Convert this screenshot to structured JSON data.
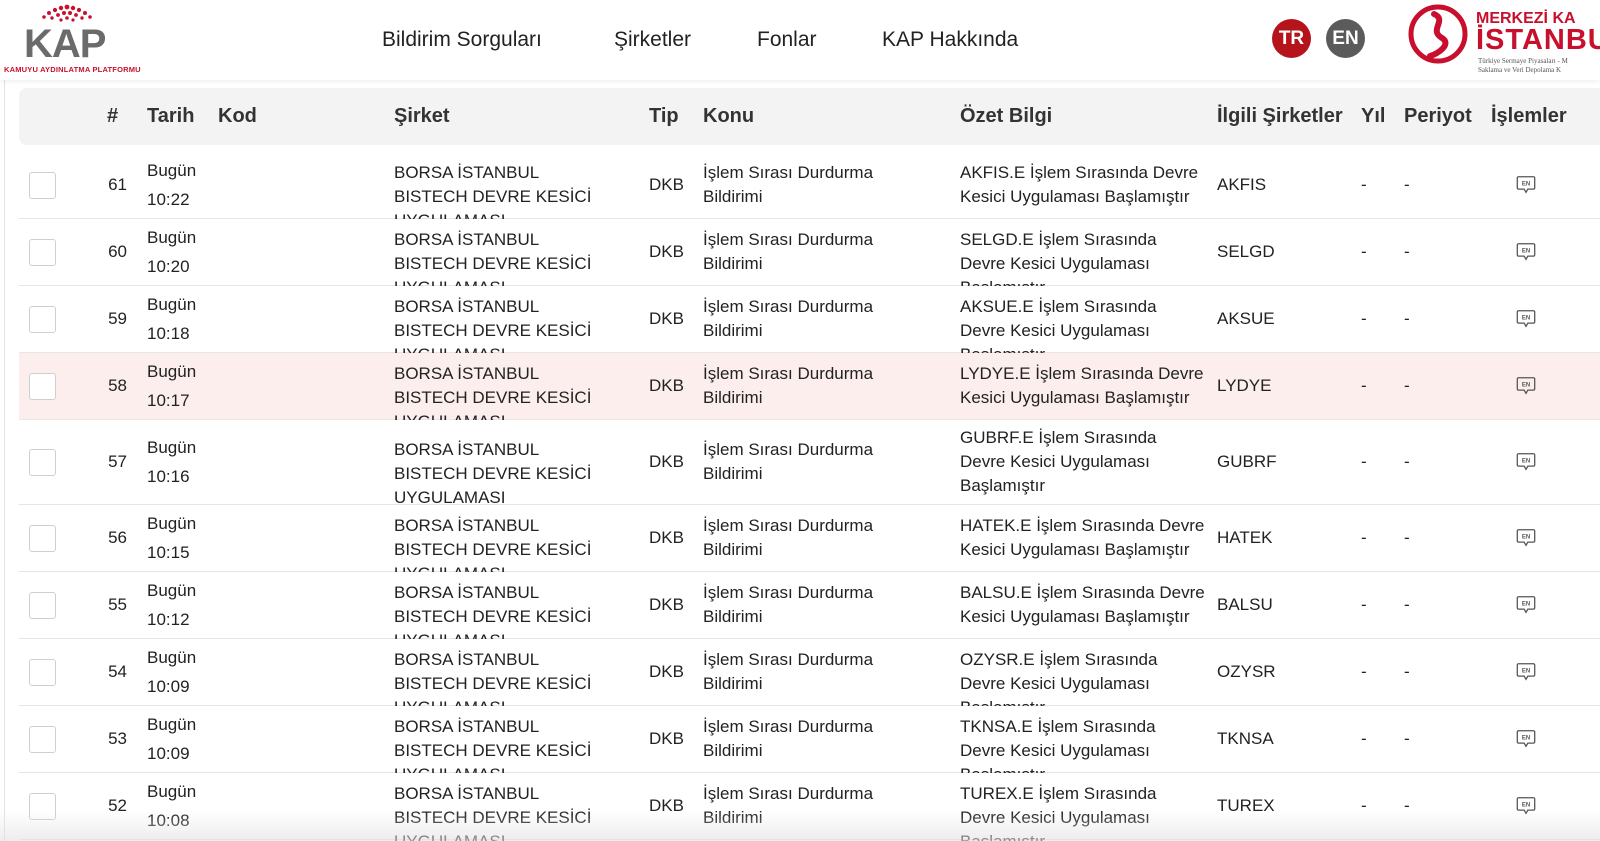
{
  "logo": {
    "text": "KAP",
    "subtitle": "KAMUYU AYDINLATMA PLATFORMU"
  },
  "nav": [
    "Bildirim Sorguları",
    "Şirketler",
    "Fonlar",
    "KAP Hakkında"
  ],
  "lang": {
    "tr": "TR",
    "en": "EN"
  },
  "mkk": {
    "line1": "MERKEZİ KA",
    "line2": "İSTANBU",
    "line3": "Türkiye Sermaye Piyasaları - M",
    "line4": "Saklama ve Veri Depolama K"
  },
  "colors": {
    "brand_red": "#c8102e",
    "tr_button": "#b5141b",
    "en_button": "#5b5b5b",
    "highlight_row": "#fdeeee",
    "header_bg": "#f3f3f3"
  },
  "headers": {
    "num": "#",
    "date": "Tarih",
    "code": "Kod",
    "company": "Şirket",
    "type": "Tip",
    "subject": "Konu",
    "summary": "Özet Bilgi",
    "related": "İlgili Şirketler",
    "year": "Yıl",
    "period": "Periyot",
    "actions": "İşlemler"
  },
  "rows": [
    {
      "num": "61",
      "day": "Bugün",
      "time": "10:22",
      "code": "",
      "company": "BORSA İSTANBUL BISTECH DEVRE KESİCİ UYGULAMASI",
      "type": "DKB",
      "subject": "İşlem Sırası Durdurma Bildirimi",
      "summary": "AKFIS.E İşlem Sırasında Devre Kesici Uygulaması Başlamıştır",
      "related": "AKFIS",
      "year": "-",
      "period": "-",
      "action_icon": "en-comment-icon"
    },
    {
      "num": "60",
      "day": "Bugün",
      "time": "10:20",
      "code": "",
      "company": "BORSA İSTANBUL BISTECH DEVRE KESİCİ UYGULAMASI",
      "type": "DKB",
      "subject": "İşlem Sırası Durdurma Bildirimi",
      "summary": "SELGD.E İşlem Sırasında Devre Kesici Uygulaması Başlamıştır",
      "related": "SELGD",
      "year": "-",
      "period": "-",
      "action_icon": "en-comment-icon"
    },
    {
      "num": "59",
      "day": "Bugün",
      "time": "10:18",
      "code": "",
      "company": "BORSA İSTANBUL BISTECH DEVRE KESİCİ UYGULAMASI",
      "type": "DKB",
      "subject": "İşlem Sırası Durdurma Bildirimi",
      "summary": "AKSUE.E İşlem Sırasında Devre Kesici Uygulaması Başlamıştır",
      "related": "AKSUE",
      "year": "-",
      "period": "-",
      "action_icon": "en-comment-icon"
    },
    {
      "num": "58",
      "day": "Bugün",
      "time": "10:17",
      "code": "",
      "company": "BORSA İSTANBUL BISTECH DEVRE KESİCİ UYGULAMASI",
      "type": "DKB",
      "subject": "İşlem Sırası Durdurma Bildirimi",
      "summary": "LYDYE.E İşlem Sırasında Devre Kesici Uygulaması Başlamıştır",
      "related": "LYDYE",
      "year": "-",
      "period": "-",
      "action_icon": "en-comment-icon",
      "highlighted": true
    },
    {
      "num": "57",
      "day": "Bugün",
      "time": "10:16",
      "code": "",
      "company": "BORSA İSTANBUL BISTECH DEVRE KESİCİ UYGULAMASI",
      "type": "DKB",
      "subject": "İşlem Sırası Durdurma Bildirimi",
      "summary": "GUBRF.E İşlem Sırasında Devre Kesici Uygulaması Başlamıştır",
      "related": "GUBRF",
      "year": "-",
      "period": "-",
      "action_icon": "en-comment-icon"
    },
    {
      "num": "56",
      "day": "Bugün",
      "time": "10:15",
      "code": "",
      "company": "BORSA İSTANBUL BISTECH DEVRE KESİCİ UYGULAMASI",
      "type": "DKB",
      "subject": "İşlem Sırası Durdurma Bildirimi",
      "summary": "HATEK.E İşlem Sırasında Devre Kesici Uygulaması Başlamıştır",
      "related": "HATEK",
      "year": "-",
      "period": "-",
      "action_icon": "en-comment-icon"
    },
    {
      "num": "55",
      "day": "Bugün",
      "time": "10:12",
      "code": "",
      "company": "BORSA İSTANBUL BISTECH DEVRE KESİCİ UYGULAMASI",
      "type": "DKB",
      "subject": "İşlem Sırası Durdurma Bildirimi",
      "summary": "BALSU.E İşlem Sırasında Devre Kesici Uygulaması Başlamıştır",
      "related": "BALSU",
      "year": "-",
      "period": "-",
      "action_icon": "en-comment-icon"
    },
    {
      "num": "54",
      "day": "Bugün",
      "time": "10:09",
      "code": "",
      "company": "BORSA İSTANBUL BISTECH DEVRE KESİCİ UYGULAMASI",
      "type": "DKB",
      "subject": "İşlem Sırası Durdurma Bildirimi",
      "summary": "OZYSR.E İşlem Sırasında Devre Kesici Uygulaması Başlamıştır",
      "related": "OZYSR",
      "year": "-",
      "period": "-",
      "action_icon": "en-comment-icon"
    },
    {
      "num": "53",
      "day": "Bugün",
      "time": "10:09",
      "code": "",
      "company": "BORSA İSTANBUL BISTECH DEVRE KESİCİ UYGULAMASI",
      "type": "DKB",
      "subject": "İşlem Sırası Durdurma Bildirimi",
      "summary": "TKNSA.E İşlem Sırasında Devre Kesici Uygulaması Başlamıştır",
      "related": "TKNSA",
      "year": "-",
      "period": "-",
      "action_icon": "en-comment-icon"
    },
    {
      "num": "52",
      "day": "Bugün",
      "time": "10:08",
      "code": "",
      "company": "BORSA İSTANBUL BISTECH DEVRE KESİCİ UYGULAMASI",
      "type": "DKB",
      "subject": "İşlem Sırası Durdurma Bildirimi",
      "summary": "TUREX.E İşlem Sırasında Devre Kesici Uygulaması Başlamıştır",
      "related": "TUREX",
      "year": "-",
      "period": "-",
      "action_icon": "en-comment-icon"
    }
  ]
}
